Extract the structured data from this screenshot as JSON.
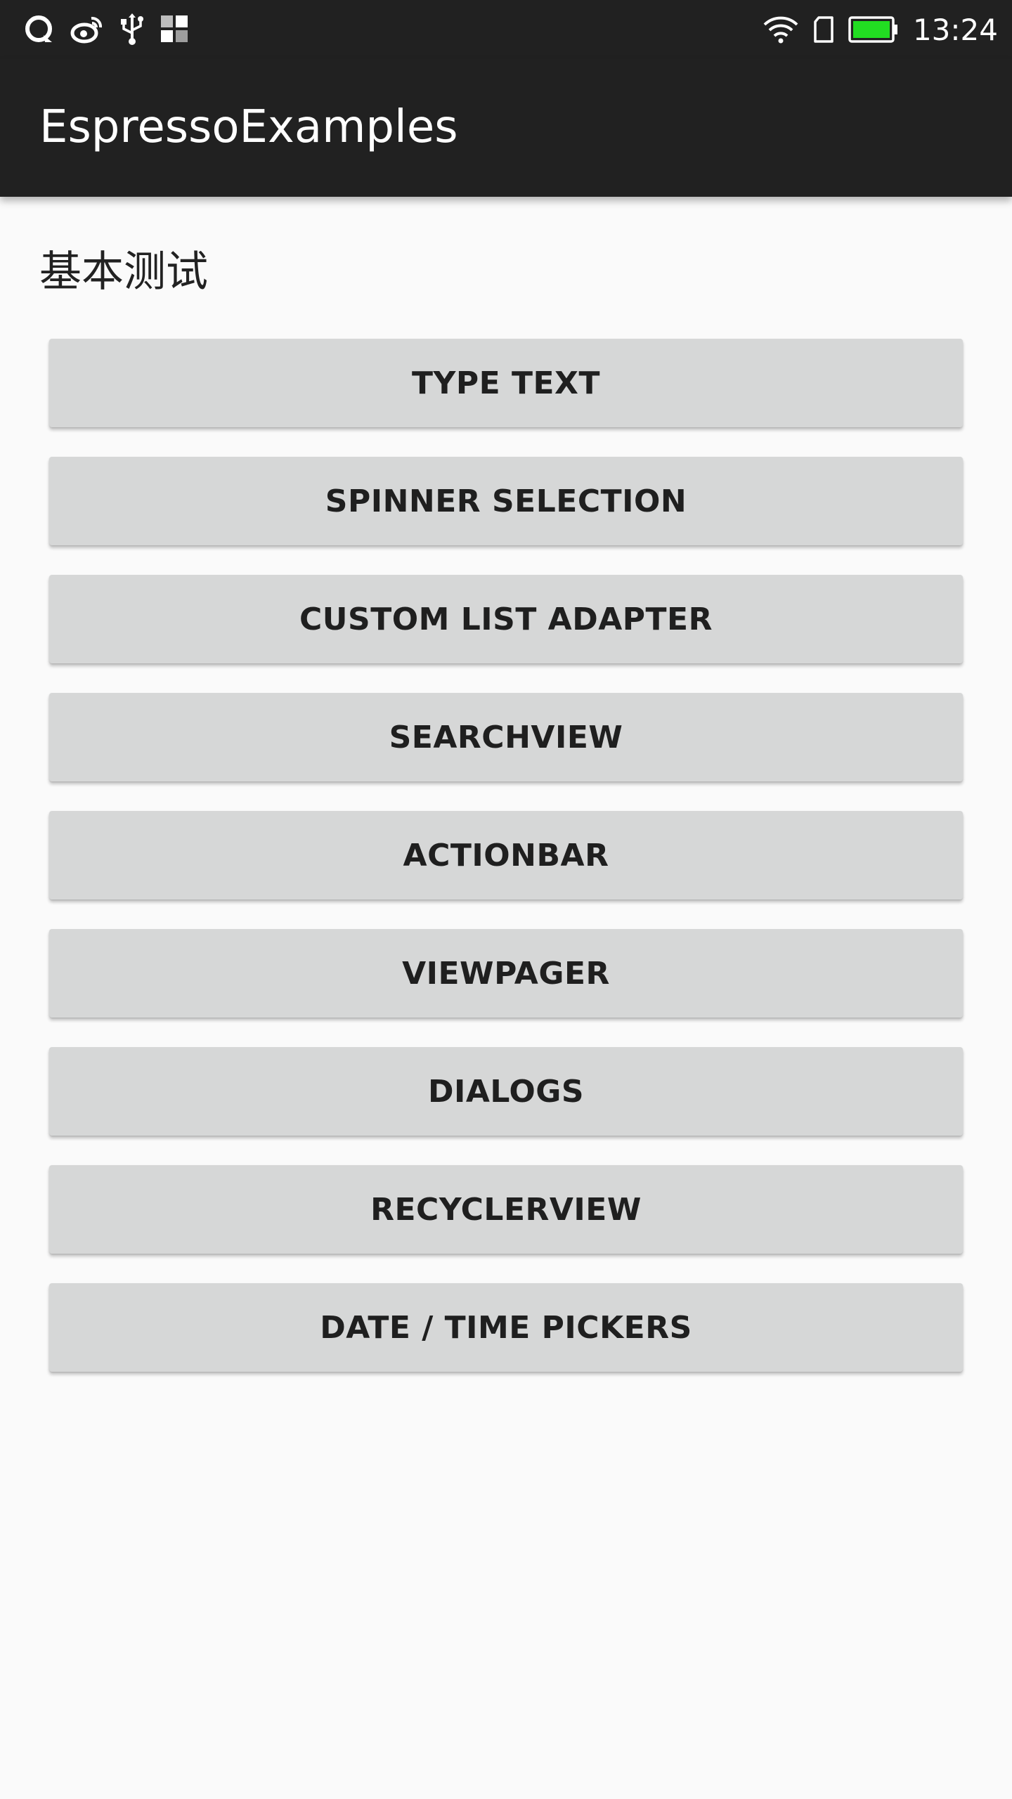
{
  "status_bar": {
    "time": "13:24",
    "icons": [
      "qq-icon",
      "weibo-icon",
      "usb-icon",
      "app-grid-icon",
      "wifi-icon",
      "sim-card-icon",
      "battery-icon"
    ],
    "battery_color": "#22dd22"
  },
  "app_bar": {
    "title": "EspressoExamples",
    "background": "#212121"
  },
  "main": {
    "section_title": "基本测试",
    "buttons": [
      {
        "label": "TYPE TEXT"
      },
      {
        "label": "SPINNER SELECTION"
      },
      {
        "label": "CUSTOM LIST ADAPTER"
      },
      {
        "label": "SEARCHVIEW"
      },
      {
        "label": "ACTIONBAR"
      },
      {
        "label": "VIEWPAGER"
      },
      {
        "label": "DIALOGS"
      },
      {
        "label": "RECYCLERVIEW"
      },
      {
        "label": "DATE / TIME PICKERS"
      }
    ]
  }
}
